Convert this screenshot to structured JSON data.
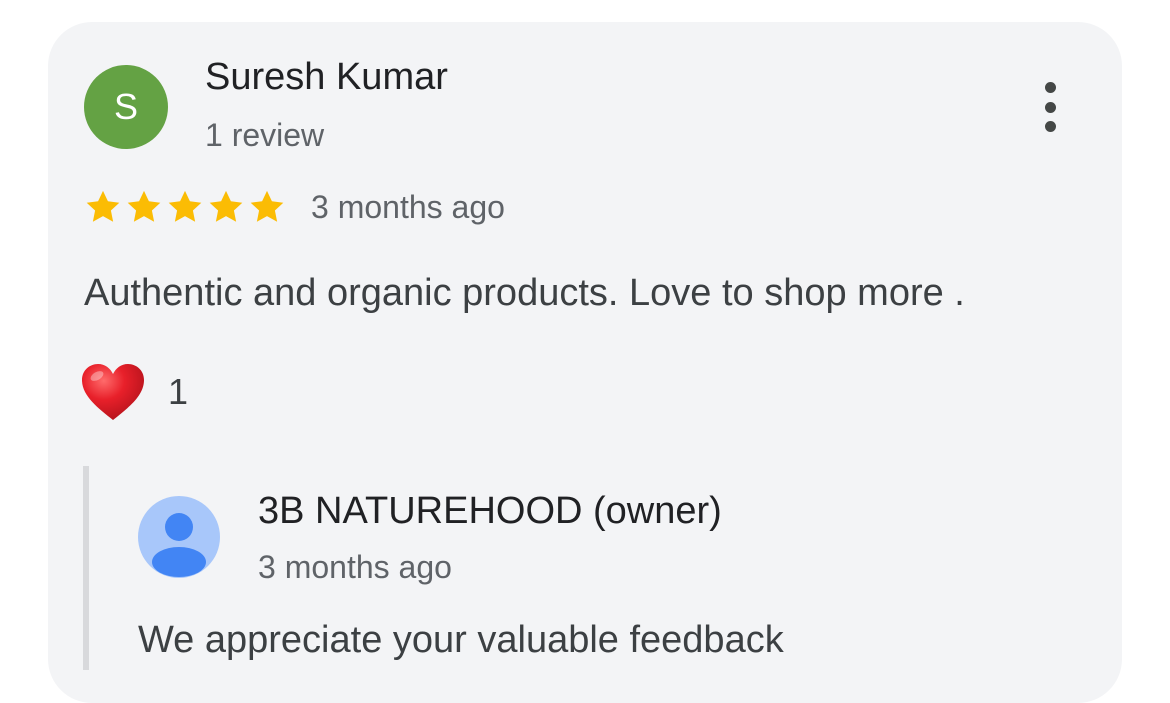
{
  "review": {
    "avatar_initial": "S",
    "reviewer_name": "Suresh Kumar",
    "review_count": "1 review",
    "rating": 5,
    "rating_max": 5,
    "time": "3 months ago",
    "text": "Authentic and organic products. Love to shop more .",
    "reaction_icon": "heart-icon",
    "reaction_count": "1",
    "more_icon": "more-vert-icon"
  },
  "owner_reply": {
    "name": "3B NATUREHOOD (owner)",
    "time": "3 months ago",
    "text": "We appreciate your valuable feedback",
    "avatar_icon": "person-icon"
  },
  "colors": {
    "card_background": "#f3f4f6",
    "avatar_green": "#64a244",
    "star_gold": "#fbbc04",
    "heart_red": "#e8202a",
    "owner_avatar_bg": "#a8c7fa",
    "owner_avatar_fg": "#4285f4"
  }
}
